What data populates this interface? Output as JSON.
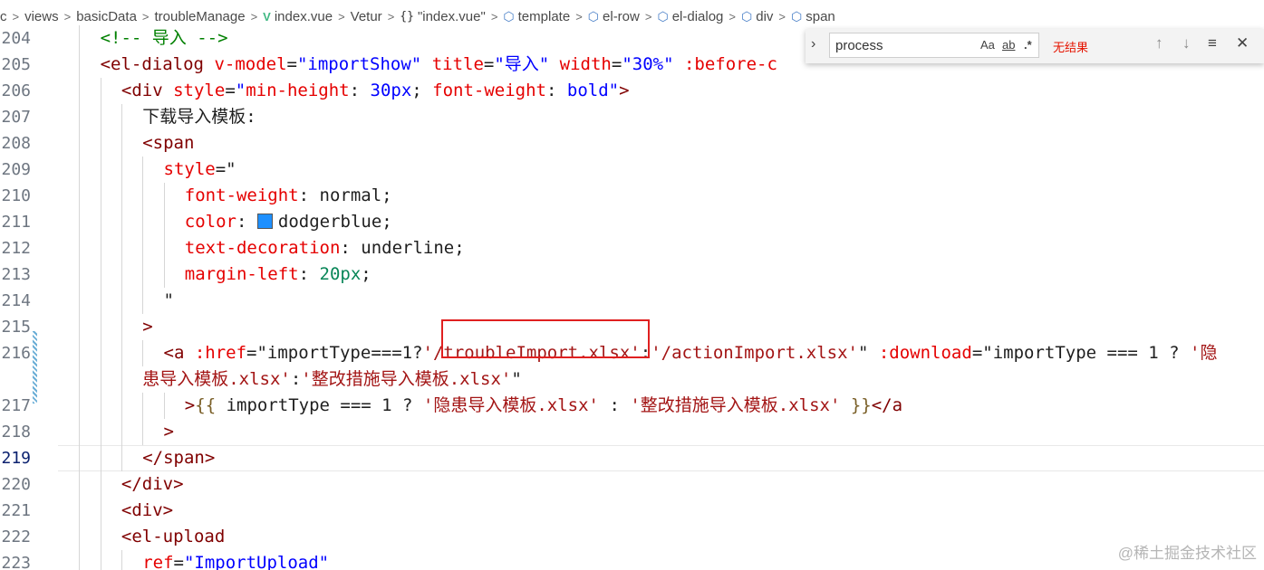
{
  "breadcrumb": {
    "items": [
      "c",
      "views",
      "basicData",
      "troubleManage",
      "index.vue",
      "Vetur",
      "\"index.vue\"",
      "template",
      "el-row",
      "el-dialog",
      "div",
      "span"
    ],
    "vue_icon": "V",
    "braces_icon": "{}",
    "separator": ">"
  },
  "find_widget": {
    "query": "process",
    "match_case": "Aa",
    "whole_word": "ab",
    "regex": ".*",
    "status": "无结果",
    "prev_icon": "arrow-up",
    "next_icon": "arrow-down"
  },
  "editor": {
    "lines": [
      {
        "n": "204",
        "parts": [
          {
            "t": "<!-- 导入 -->",
            "c": "com"
          }
        ]
      },
      {
        "n": "205",
        "parts": [
          {
            "t": "<",
            "c": "br"
          },
          {
            "t": "el-dialog",
            "c": "tag"
          },
          {
            "t": " v-model",
            "c": "attr"
          },
          {
            "t": "=",
            "c": "txt"
          },
          {
            "t": "\"importShow\"",
            "c": "str"
          },
          {
            "t": " title",
            "c": "attr"
          },
          {
            "t": "=",
            "c": "txt"
          },
          {
            "t": "\"导入\"",
            "c": "str"
          },
          {
            "t": " width",
            "c": "attr"
          },
          {
            "t": "=",
            "c": "txt"
          },
          {
            "t": "\"30%\"",
            "c": "str"
          },
          {
            "t": " :before-c",
            "c": "attr"
          }
        ]
      },
      {
        "n": "206",
        "parts": [
          {
            "t": "<",
            "c": "br"
          },
          {
            "t": "div",
            "c": "tag"
          },
          {
            "t": " style",
            "c": "attr"
          },
          {
            "t": "=",
            "c": "txt"
          },
          {
            "t": "\"",
            "c": "str"
          },
          {
            "t": "min-height",
            "c": "attr"
          },
          {
            "t": ": ",
            "c": "txt"
          },
          {
            "t": "30px",
            "c": "str"
          },
          {
            "t": "; ",
            "c": "txt"
          },
          {
            "t": "font-weight",
            "c": "attr"
          },
          {
            "t": ": ",
            "c": "txt"
          },
          {
            "t": "bold",
            "c": "str"
          },
          {
            "t": "\"",
            "c": "str"
          },
          {
            "t": ">",
            "c": "br"
          }
        ]
      },
      {
        "n": "207",
        "parts": [
          {
            "t": "下载导入模板:",
            "c": "txt"
          }
        ]
      },
      {
        "n": "208",
        "parts": [
          {
            "t": "<",
            "c": "br"
          },
          {
            "t": "span",
            "c": "tag"
          }
        ]
      },
      {
        "n": "209",
        "parts": [
          {
            "t": "style",
            "c": "attr"
          },
          {
            "t": "=\"",
            "c": "txt"
          }
        ]
      },
      {
        "n": "210",
        "parts": [
          {
            "t": "font-weight",
            "c": "attr"
          },
          {
            "t": ": normal;",
            "c": "txt"
          }
        ]
      },
      {
        "n": "211",
        "parts": [
          {
            "t": "color",
            "c": "attr"
          },
          {
            "t": ": ",
            "c": "txt"
          },
          {
            "t": "[swatch]",
            "c": "swatch"
          },
          {
            "t": "dodgerblue;",
            "c": "txt"
          }
        ]
      },
      {
        "n": "212",
        "parts": [
          {
            "t": "text-decoration",
            "c": "attr"
          },
          {
            "t": ": underline;",
            "c": "txt"
          }
        ]
      },
      {
        "n": "213",
        "parts": [
          {
            "t": "margin-left",
            "c": "attr"
          },
          {
            "t": ": ",
            "c": "txt"
          },
          {
            "t": "20px",
            "c": "num"
          },
          {
            "t": ";",
            "c": "txt"
          }
        ]
      },
      {
        "n": "214",
        "parts": [
          {
            "t": "\"",
            "c": "txt"
          }
        ]
      },
      {
        "n": "215",
        "parts": [
          {
            "t": ">",
            "c": "br"
          }
        ]
      },
      {
        "n": "216",
        "parts": [
          {
            "t": "<",
            "c": "br"
          },
          {
            "t": "a",
            "c": "tag"
          },
          {
            "t": " :href",
            "c": "attr"
          },
          {
            "t": "=\"importType===1?",
            "c": "txt"
          },
          {
            "t": "'/troubleImport.xlsx'",
            "c": "key"
          },
          {
            "t": ":",
            "c": "txt"
          },
          {
            "t": "'/actionImport.xlsx'",
            "c": "key"
          },
          {
            "t": "\"",
            "c": "txt"
          },
          {
            "t": " :download",
            "c": "attr"
          },
          {
            "t": "=\"importType === 1 ? ",
            "c": "txt"
          },
          {
            "t": "'隐",
            "c": "key"
          }
        ]
      },
      {
        "n": "",
        "parts": [
          {
            "t": "患导入模板.xlsx'",
            "c": "key"
          },
          {
            "t": ":",
            "c": "txt"
          },
          {
            "t": "'整改措施导入模板.xlsx'",
            "c": "key"
          },
          {
            "t": "\"",
            "c": "txt"
          }
        ]
      },
      {
        "n": "217",
        "parts": [
          {
            "t": ">",
            "c": "br"
          },
          {
            "t": "{{",
            "c": "yel"
          },
          {
            "t": " importType === 1 ? ",
            "c": "txt"
          },
          {
            "t": "'隐患导入模板.xlsx'",
            "c": "key"
          },
          {
            "t": " : ",
            "c": "txt"
          },
          {
            "t": "'整改措施导入模板.xlsx'",
            "c": "key"
          },
          {
            "t": " }}",
            "c": "yel"
          },
          {
            "t": "</",
            "c": "br"
          },
          {
            "t": "a",
            "c": "tag"
          }
        ]
      },
      {
        "n": "218",
        "parts": [
          {
            "t": ">",
            "c": "br"
          }
        ]
      },
      {
        "n": "219",
        "parts": [
          {
            "t": "</",
            "c": "br"
          },
          {
            "t": "span",
            "c": "tag"
          },
          {
            "t": ">",
            "c": "br"
          }
        ]
      },
      {
        "n": "220",
        "parts": [
          {
            "t": "</",
            "c": "br"
          },
          {
            "t": "div",
            "c": "tag"
          },
          {
            "t": ">",
            "c": "br"
          }
        ]
      },
      {
        "n": "221",
        "parts": [
          {
            "t": "<",
            "c": "br"
          },
          {
            "t": "div",
            "c": "tag"
          },
          {
            "t": ">",
            "c": "br"
          }
        ]
      },
      {
        "n": "222",
        "parts": [
          {
            "t": "<",
            "c": "br"
          },
          {
            "t": "el-upload",
            "c": "tag"
          }
        ]
      },
      {
        "n": "223",
        "parts": [
          {
            "t": "ref",
            "c": "attr"
          },
          {
            "t": "=",
            "c": "txt"
          },
          {
            "t": "\"ImportUpload\"",
            "c": "str"
          }
        ]
      }
    ],
    "active_line": "219"
  },
  "watermark": "@稀土掘金技术社区"
}
